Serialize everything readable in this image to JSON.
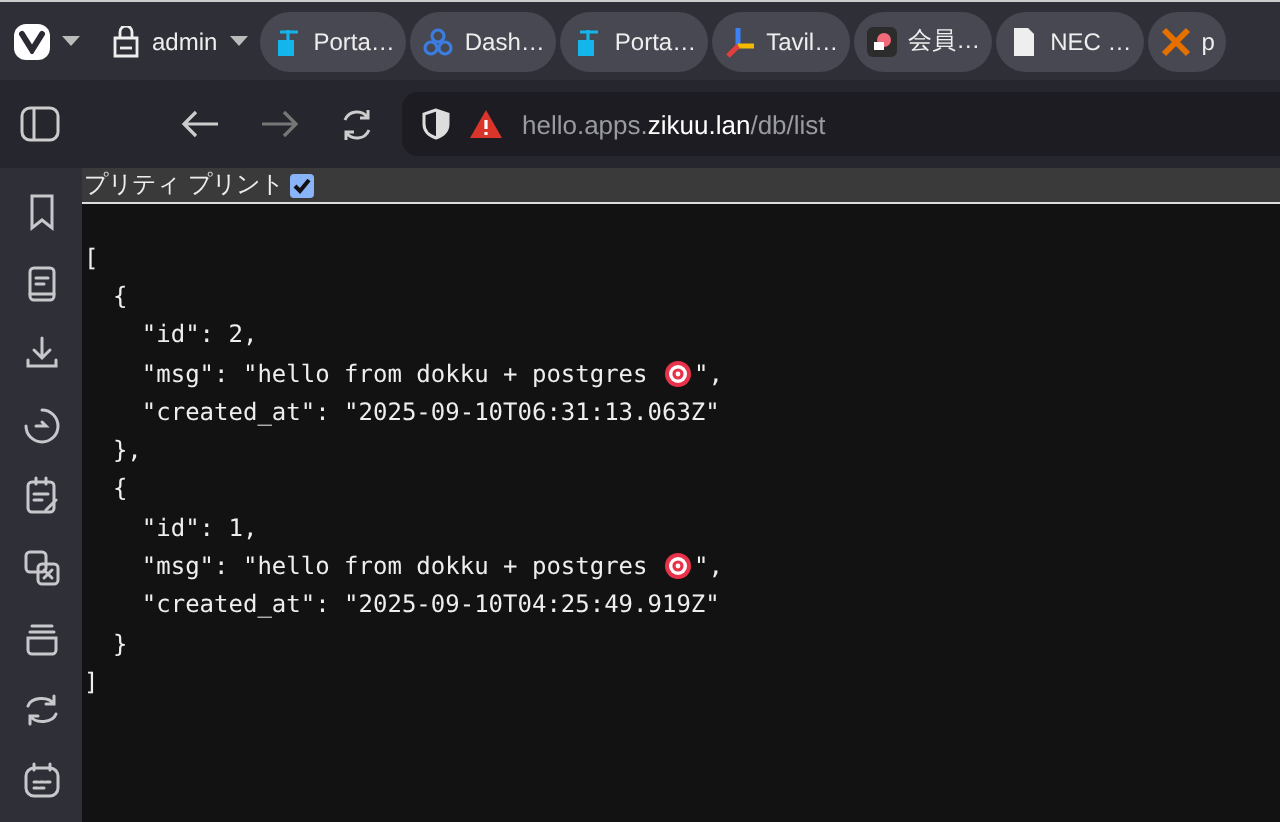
{
  "workspace": {
    "label": "admin"
  },
  "tabs": [
    {
      "label": "Porta…"
    },
    {
      "label": "Dash…"
    },
    {
      "label": "Porta…"
    },
    {
      "label": "Tavil…"
    },
    {
      "label": "会員…"
    },
    {
      "label": "NEC …"
    },
    {
      "label": "p"
    }
  ],
  "address": {
    "prefix": "hello.apps.",
    "domain": "zikuu.lan",
    "path": "/db/list"
  },
  "pretty_print": {
    "label": "プリティ プリント",
    "checked": true
  },
  "json_lines": [
    {
      "text": "["
    },
    {
      "text": "  {"
    },
    {
      "text": "    \"id\": 2,"
    },
    {
      "text": "    \"msg\": \"hello from dokku + postgres ",
      "after": "\","
    },
    {
      "text": "    \"created_at\": \"2025-09-10T06:31:13.063Z\""
    },
    {
      "text": "  },"
    },
    {
      "text": "  {"
    },
    {
      "text": "    \"id\": 1,"
    },
    {
      "text": "    \"msg\": \"hello from dokku + postgres ",
      "after": "\","
    },
    {
      "text": "    \"created_at\": \"2025-09-10T04:25:49.919Z\""
    },
    {
      "text": "  }"
    },
    {
      "text": "]"
    }
  ]
}
